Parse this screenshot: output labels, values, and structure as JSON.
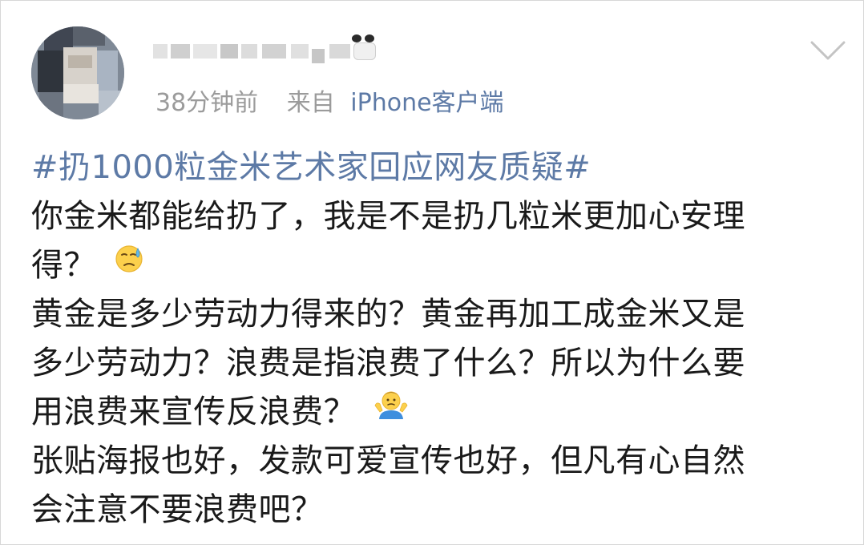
{
  "post": {
    "username": "",
    "time": "38分钟前",
    "source_label": "来自",
    "source_client": "iPhone客户端",
    "hashtag": "#扔1000粒金米艺术家回应网友质疑#",
    "lines": [
      "你金米都能给扔了，我是不是扔几粒米更加心安理",
      "得？",
      "黄金是多少劳动力得来的？黄金再加工成金米又是",
      "多少劳动力？浪费是指浪费了什么？所以为什么要",
      "用浪费来宣传反浪费？",
      "张贴海报也好，发款可爱宣传也好，但凡有心自然",
      "会注意不要浪费吧？"
    ]
  },
  "icons": {
    "menu": "chevron-down-icon",
    "emoji_1": "sweat-face-emoji",
    "emoji_2": "shrug-person-emoji"
  },
  "colors": {
    "link": "#5d7aa6",
    "meta": "#9b9b9b",
    "text": "#1a1a1a"
  }
}
